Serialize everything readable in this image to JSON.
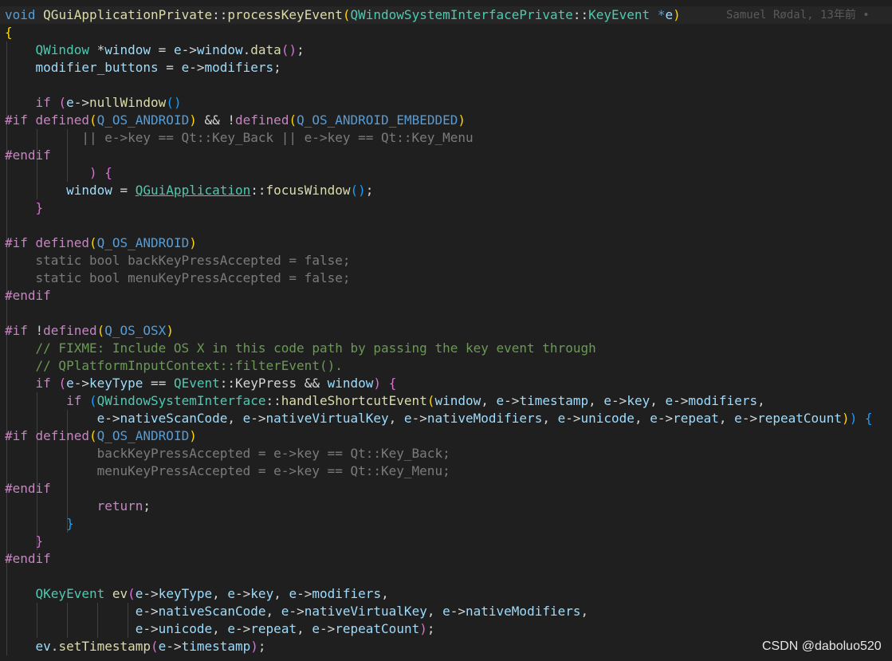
{
  "blame": "Samuel Rødal, 13年前 •",
  "watermark": "CSDN @daboluo520",
  "lines": [
    [
      [
        "kw",
        "void "
      ],
      [
        "fn",
        "QGuiApplicationPrivate"
      ],
      [
        "pl",
        "::"
      ],
      [
        "fn",
        "processKeyEvent"
      ],
      [
        "b1",
        "("
      ],
      [
        "tp",
        "QWindowSystemInterfacePrivate"
      ],
      [
        "pl",
        "::"
      ],
      [
        "tp",
        "KeyEvent"
      ],
      [
        "kw",
        " *"
      ],
      [
        "vr",
        "e"
      ],
      [
        "b1",
        ")"
      ]
    ],
    [
      [
        "b1",
        "{"
      ]
    ],
    [
      [
        "pl",
        "    "
      ],
      [
        "tp",
        "QWindow"
      ],
      [
        "pl",
        " *"
      ],
      [
        "vr",
        "window"
      ],
      [
        "pl",
        " = "
      ],
      [
        "vr",
        "e"
      ],
      [
        "pl",
        "->"
      ],
      [
        "vr",
        "window"
      ],
      [
        "pl",
        "."
      ],
      [
        "fn",
        "data"
      ],
      [
        "b2",
        "()"
      ],
      [
        "pl",
        ";"
      ]
    ],
    [
      [
        "pl",
        "    "
      ],
      [
        "vr",
        "modifier_buttons"
      ],
      [
        "pl",
        " = "
      ],
      [
        "vr",
        "e"
      ],
      [
        "pl",
        "->"
      ],
      [
        "vr",
        "modifiers"
      ],
      [
        "pl",
        ";"
      ]
    ],
    [],
    [
      [
        "pl",
        "    "
      ],
      [
        "ctl",
        "if "
      ],
      [
        "b2",
        "("
      ],
      [
        "vr",
        "e"
      ],
      [
        "pl",
        "->"
      ],
      [
        "fn",
        "nullWindow"
      ],
      [
        "b3",
        "()"
      ]
    ],
    [
      [
        "pp",
        "#if "
      ],
      [
        "pp",
        "defined"
      ],
      [
        "b1",
        "("
      ],
      [
        "mc",
        "Q_OS_ANDROID"
      ],
      [
        "b1",
        ")"
      ],
      [
        "pl",
        " && !"
      ],
      [
        "pp",
        "defined"
      ],
      [
        "b1",
        "("
      ],
      [
        "mc",
        "Q_OS_ANDROID_EMBEDDED"
      ],
      [
        "b1",
        ")"
      ]
    ],
    [
      [
        "pl",
        "          "
      ],
      [
        "in",
        "|| e->key == Qt::Key_Back || e->key == Qt::Key_Menu"
      ]
    ],
    [
      [
        "pp",
        "#endif"
      ]
    ],
    [
      [
        "pl",
        "           "
      ],
      [
        "b2",
        ")"
      ],
      [
        "pl",
        " "
      ],
      [
        "b2",
        "{"
      ]
    ],
    [
      [
        "pl",
        "        "
      ],
      [
        "vr",
        "window"
      ],
      [
        "pl",
        " = "
      ],
      [
        "tp lnk",
        "QGuiApplication"
      ],
      [
        "pl",
        "::"
      ],
      [
        "fn",
        "focusWindow"
      ],
      [
        "b3",
        "()"
      ],
      [
        "pl",
        ";"
      ]
    ],
    [
      [
        "pl",
        "    "
      ],
      [
        "b2",
        "}"
      ]
    ],
    [],
    [
      [
        "pp",
        "#if "
      ],
      [
        "pp",
        "defined"
      ],
      [
        "b1",
        "("
      ],
      [
        "mc",
        "Q_OS_ANDROID"
      ],
      [
        "b1",
        ")"
      ]
    ],
    [
      [
        "pl",
        "    "
      ],
      [
        "in",
        "static bool backKeyPressAccepted = false;"
      ]
    ],
    [
      [
        "pl",
        "    "
      ],
      [
        "in",
        "static bool menuKeyPressAccepted = false;"
      ]
    ],
    [
      [
        "pp",
        "#endif"
      ]
    ],
    [],
    [
      [
        "pp",
        "#if "
      ],
      [
        "pl",
        "!"
      ],
      [
        "pp",
        "defined"
      ],
      [
        "b1",
        "("
      ],
      [
        "mc",
        "Q_OS_OSX"
      ],
      [
        "b1",
        ")"
      ]
    ],
    [
      [
        "pl",
        "    "
      ],
      [
        "cm",
        "// FIXME: Include OS X in this code path by passing the key event through"
      ]
    ],
    [
      [
        "pl",
        "    "
      ],
      [
        "cm",
        "// QPlatformInputContext::filterEvent()."
      ]
    ],
    [
      [
        "pl",
        "    "
      ],
      [
        "ctl",
        "if "
      ],
      [
        "b2",
        "("
      ],
      [
        "vr",
        "e"
      ],
      [
        "pl",
        "->"
      ],
      [
        "vr",
        "keyType"
      ],
      [
        "pl",
        " == "
      ],
      [
        "tp",
        "QEvent"
      ],
      [
        "pl",
        "::KeyPress && "
      ],
      [
        "vr",
        "window"
      ],
      [
        "b2",
        ")"
      ],
      [
        "pl",
        " "
      ],
      [
        "b2",
        "{"
      ]
    ],
    [
      [
        "pl",
        "        "
      ],
      [
        "ctl",
        "if "
      ],
      [
        "b3",
        "("
      ],
      [
        "tp",
        "QWindowSystemInterface"
      ],
      [
        "pl",
        "::"
      ],
      [
        "fn",
        "handleShortcutEvent"
      ],
      [
        "b1",
        "("
      ],
      [
        "vr",
        "window"
      ],
      [
        "pl",
        ", "
      ],
      [
        "vr",
        "e"
      ],
      [
        "pl",
        "->"
      ],
      [
        "vr",
        "timestamp"
      ],
      [
        "pl",
        ", "
      ],
      [
        "vr",
        "e"
      ],
      [
        "pl",
        "->"
      ],
      [
        "vr",
        "key"
      ],
      [
        "pl",
        ", "
      ],
      [
        "vr",
        "e"
      ],
      [
        "pl",
        "->"
      ],
      [
        "vr",
        "modifiers"
      ],
      [
        "pl",
        ","
      ]
    ],
    [
      [
        "pl",
        "            "
      ],
      [
        "vr",
        "e"
      ],
      [
        "pl",
        "->"
      ],
      [
        "vr",
        "nativeScanCode"
      ],
      [
        "pl",
        ", "
      ],
      [
        "vr",
        "e"
      ],
      [
        "pl",
        "->"
      ],
      [
        "vr",
        "nativeVirtualKey"
      ],
      [
        "pl",
        ", "
      ],
      [
        "vr",
        "e"
      ],
      [
        "pl",
        "->"
      ],
      [
        "vr",
        "nativeModifiers"
      ],
      [
        "pl",
        ", "
      ],
      [
        "vr",
        "e"
      ],
      [
        "pl",
        "->"
      ],
      [
        "vr",
        "unicode"
      ],
      [
        "pl",
        ", "
      ],
      [
        "vr",
        "e"
      ],
      [
        "pl",
        "->"
      ],
      [
        "vr",
        "repeat"
      ],
      [
        "pl",
        ", "
      ],
      [
        "vr",
        "e"
      ],
      [
        "pl",
        "->"
      ],
      [
        "vr",
        "repeatCount"
      ],
      [
        "b1",
        ")"
      ],
      [
        "b3",
        ")"
      ],
      [
        "pl",
        " "
      ],
      [
        "b3",
        "{"
      ]
    ],
    [
      [
        "pp",
        "#if "
      ],
      [
        "pp",
        "defined"
      ],
      [
        "b1",
        "("
      ],
      [
        "mc",
        "Q_OS_ANDROID"
      ],
      [
        "b1",
        ")"
      ]
    ],
    [
      [
        "pl",
        "            "
      ],
      [
        "in",
        "backKeyPressAccepted = e->key == Qt::Key_Back;"
      ]
    ],
    [
      [
        "pl",
        "            "
      ],
      [
        "in",
        "menuKeyPressAccepted = e->key == Qt::Key_Menu;"
      ]
    ],
    [
      [
        "pp",
        "#endif"
      ]
    ],
    [
      [
        "pl",
        "            "
      ],
      [
        "ctl",
        "return"
      ],
      [
        "pl",
        ";"
      ]
    ],
    [
      [
        "pl",
        "        "
      ],
      [
        "b3",
        "}"
      ]
    ],
    [
      [
        "pl",
        "    "
      ],
      [
        "b2",
        "}"
      ]
    ],
    [
      [
        "pp",
        "#endif"
      ]
    ],
    [],
    [
      [
        "pl",
        "    "
      ],
      [
        "tp",
        "QKeyEvent"
      ],
      [
        "pl",
        " "
      ],
      [
        "fn",
        "ev"
      ],
      [
        "b2",
        "("
      ],
      [
        "vr",
        "e"
      ],
      [
        "pl",
        "->"
      ],
      [
        "vr",
        "keyType"
      ],
      [
        "pl",
        ", "
      ],
      [
        "vr",
        "e"
      ],
      [
        "pl",
        "->"
      ],
      [
        "vr",
        "key"
      ],
      [
        "pl",
        ", "
      ],
      [
        "vr",
        "e"
      ],
      [
        "pl",
        "->"
      ],
      [
        "vr",
        "modifiers"
      ],
      [
        "pl",
        ","
      ]
    ],
    [
      [
        "pl",
        "                 "
      ],
      [
        "vr",
        "e"
      ],
      [
        "pl",
        "->"
      ],
      [
        "vr",
        "nativeScanCode"
      ],
      [
        "pl",
        ", "
      ],
      [
        "vr",
        "e"
      ],
      [
        "pl",
        "->"
      ],
      [
        "vr",
        "nativeVirtualKey"
      ],
      [
        "pl",
        ", "
      ],
      [
        "vr",
        "e"
      ],
      [
        "pl",
        "->"
      ],
      [
        "vr",
        "nativeModifiers"
      ],
      [
        "pl",
        ","
      ]
    ],
    [
      [
        "pl",
        "                 "
      ],
      [
        "vr",
        "e"
      ],
      [
        "pl",
        "->"
      ],
      [
        "vr",
        "unicode"
      ],
      [
        "pl",
        ", "
      ],
      [
        "vr",
        "e"
      ],
      [
        "pl",
        "->"
      ],
      [
        "vr",
        "repeat"
      ],
      [
        "pl",
        ", "
      ],
      [
        "vr",
        "e"
      ],
      [
        "pl",
        "->"
      ],
      [
        "vr",
        "repeatCount"
      ],
      [
        "b2",
        ")"
      ],
      [
        "pl",
        ";"
      ]
    ],
    [
      [
        "pl",
        "    "
      ],
      [
        "vr",
        "ev"
      ],
      [
        "pl",
        "."
      ],
      [
        "fn",
        "setTimestamp"
      ],
      [
        "b2",
        "("
      ],
      [
        "vr",
        "e"
      ],
      [
        "pl",
        "->"
      ],
      [
        "vr",
        "timestamp"
      ],
      [
        "b2",
        ")"
      ],
      [
        "pl",
        ";"
      ]
    ]
  ]
}
